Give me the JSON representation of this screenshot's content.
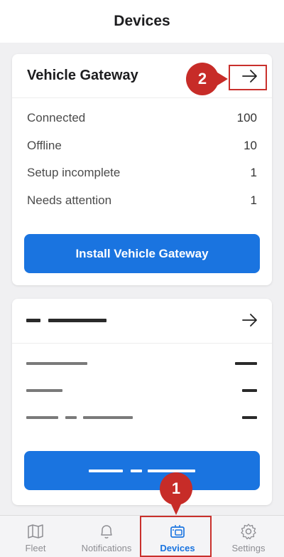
{
  "header": {
    "title": "Devices"
  },
  "gateway_card": {
    "title": "Vehicle Gateway",
    "rows": [
      {
        "label": "Connected",
        "value": "100"
      },
      {
        "label": "Offline",
        "value": "10"
      },
      {
        "label": "Setup incomplete",
        "value": "1"
      },
      {
        "label": "Needs attention",
        "value": "1"
      }
    ],
    "button_label": "Install Vehicle Gateway"
  },
  "tabs": [
    {
      "label": "Fleet",
      "icon": "map-icon",
      "active": false
    },
    {
      "label": "Notifications",
      "icon": "bell-icon",
      "active": false
    },
    {
      "label": "Devices",
      "icon": "devices-icon",
      "active": true
    },
    {
      "label": "Settings",
      "icon": "gear-icon",
      "active": false
    }
  ],
  "annotations": {
    "step1": "1",
    "step2": "2",
    "color": "#c72c28"
  },
  "colors": {
    "accent": "#1a74e0",
    "inactive": "#8e8e93"
  }
}
